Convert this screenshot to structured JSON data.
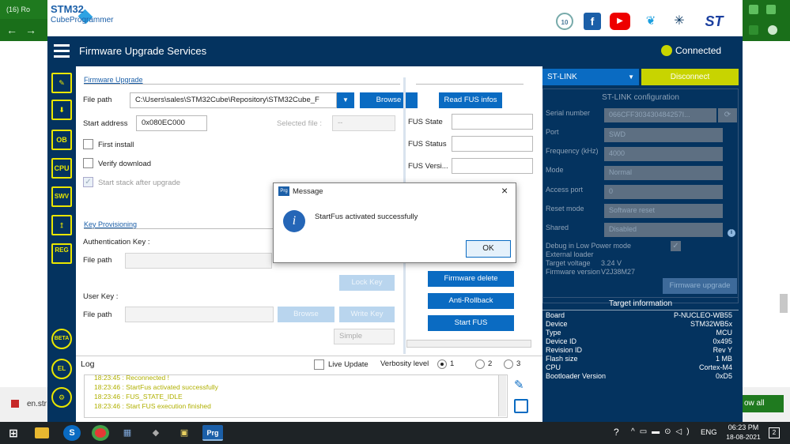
{
  "browser": {
    "tab_title": "(16) Ro",
    "right_text": "ow all",
    "left_bottom": "en.str"
  },
  "app": {
    "logo_line1": "STM32",
    "logo_line2": "CubeProgrammer",
    "title": "Firmware Upgrade Services",
    "status": "Connected",
    "status_color": "#c8d400",
    "social_icons": [
      "anniversary-icon",
      "facebook-icon",
      "youtube-icon",
      "twitter-icon",
      "network-icon",
      "st-logo"
    ]
  },
  "sidebar": {
    "items": [
      {
        "name": "edit-icon",
        "label": ""
      },
      {
        "name": "download-icon",
        "label": ""
      },
      {
        "name": "ob-icon",
        "label": "OB"
      },
      {
        "name": "cpu-icon",
        "label": "CPU"
      },
      {
        "name": "swv-icon",
        "label": "SWV"
      },
      {
        "name": "rss-icon",
        "label": ""
      },
      {
        "name": "reg-icon",
        "label": "REG"
      }
    ],
    "bottom": [
      "BETA",
      "EL"
    ]
  },
  "fw_upgrade": {
    "section_title": "Firmware Upgrade",
    "file_path_label": "File path",
    "file_path_value": "C:\\Users\\sales\\STM32Cube\\Repository\\STM32Cube_F",
    "browse": "Browse",
    "start_address_label": "Start address",
    "start_address_value": "0x080EC000",
    "selected_file_label": "Selected file :",
    "selected_file_value": "--",
    "first_install": "First install",
    "verify_download": "Verify download",
    "start_stack": "Start stack after upgrade"
  },
  "fus": {
    "read_btn": "Read FUS infos",
    "state_label": "FUS State",
    "status_label": "FUS Status",
    "version_label": "FUS Versi...",
    "fw_delete": "Firmware delete",
    "anti_rollback": "Anti-Rollback",
    "start_fus": "Start FUS"
  },
  "key_prov": {
    "section_title": "Key Provisioning",
    "auth_key_label": "Authentication Key :",
    "file_path_label": "File path",
    "lock_key": "Lock Key",
    "user_key_label": "User Key :",
    "file_path_label2": "File path",
    "browse": "Browse",
    "write_key": "Write Key",
    "simple": "Simple"
  },
  "log": {
    "title": "Log",
    "live_update": "Live Update",
    "verbosity": "Verbosity level",
    "levels": [
      "1",
      "2",
      "3"
    ],
    "lines": [
      "18:23:45 : Reconnected !",
      "18:23:46 : StartFus activated successfully",
      "18:23:46 : FUS_STATE_IDLE",
      "18:23:46 : Start FUS execution finished"
    ]
  },
  "stlink": {
    "selector": "ST-LINK",
    "disconnect": "Disconnect",
    "config_title": "ST-LINK configuration",
    "serial_label": "Serial number",
    "serial_value": "066CFF303430484257I...",
    "port_label": "Port",
    "port_value": "SWD",
    "freq_label": "Frequency (kHz)",
    "freq_value": "4000",
    "mode_label": "Mode",
    "mode_value": "Normal",
    "access_label": "Access port",
    "access_value": "0",
    "reset_label": "Reset mode",
    "reset_value": "Software reset",
    "shared_label": "Shared",
    "shared_value": "Disabled",
    "debug_lp": "Debug in Low Power mode",
    "ext_loader": "External loader",
    "ext_loader_value": "",
    "target_voltage_label": "Target voltage",
    "target_voltage_value": "3.24 V",
    "fw_version_label": "Firmware version",
    "fw_version_value": "V2J38M27",
    "fw_upgrade_btn": "Firmware upgrade",
    "target_info_title": "Target information",
    "target_info": [
      {
        "k": "Board",
        "v": "P-NUCLEO-WB55"
      },
      {
        "k": "Device",
        "v": "STM32WB5x"
      },
      {
        "k": "Type",
        "v": "MCU"
      },
      {
        "k": "Device ID",
        "v": "0x495"
      },
      {
        "k": "Revision ID",
        "v": "Rev Y"
      },
      {
        "k": "Flash size",
        "v": "1 MB"
      },
      {
        "k": "CPU",
        "v": "Cortex-M4"
      },
      {
        "k": "Bootloader Version",
        "v": "0xD5"
      }
    ]
  },
  "dialog": {
    "title": "Message",
    "icon_text": "Prg",
    "message": "StartFus activated successfully",
    "ok": "OK"
  },
  "taskbar": {
    "time": "06:23 PM",
    "date": "18-08-2021",
    "lang": "ENG",
    "apps": [
      "windows-icon",
      "search-icon",
      "folder-icon",
      "s-icon",
      "chrome-icon",
      "virtualbox-icon",
      "app1-icon",
      "app2-icon",
      "prg-icon"
    ],
    "prg_label": "Prg",
    "notif_count": "2"
  }
}
